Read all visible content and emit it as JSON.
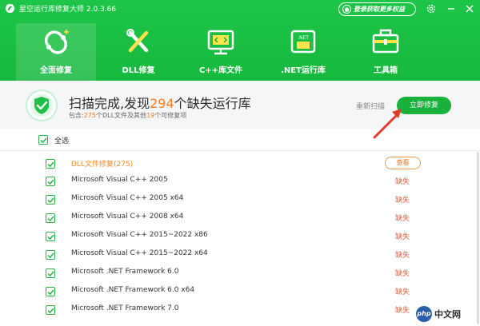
{
  "app": {
    "title": "星空运行库修复大师 2.0.3.66"
  },
  "titlebar": {
    "login_label": "登录获取更多权益",
    "icons": [
      "settings-icon",
      "minimize-icon",
      "close-icon"
    ]
  },
  "nav": {
    "items": [
      {
        "label": "全面修复",
        "icon": "refresh-circle-icon",
        "active": true
      },
      {
        "label": "DLL修复",
        "icon": "wrench-icon"
      },
      {
        "label": "C++库文件",
        "icon": "code-monitor-icon"
      },
      {
        "label": ".NET运行库",
        "icon": "net-folder-icon"
      },
      {
        "label": "工具箱",
        "icon": "toolbox-icon"
      }
    ]
  },
  "summary": {
    "title_prefix": "扫描完成,发现",
    "title_count": "294",
    "title_suffix": "个缺失运行库",
    "sub_prefix": "包含:",
    "sub_dll_count": "275",
    "sub_middle": "个DLL文件及其他",
    "sub_other_count": "19",
    "sub_suffix": "个可修复项",
    "rescan_label": "重新扫描",
    "fix_label": "立即修复"
  },
  "list": {
    "select_all_label": "全选",
    "rows": [
      {
        "label": "DLL文件修复(275)",
        "action": "查看",
        "checked": true
      },
      {
        "label": "Microsoft Visual C++ 2005",
        "status": "缺失",
        "checked": true
      },
      {
        "label": "Microsoft Visual C++ 2005 x64",
        "status": "缺失",
        "checked": true
      },
      {
        "label": "Microsoft Visual C++ 2008 x64",
        "status": "缺失",
        "checked": true
      },
      {
        "label": "Microsoft Visual C++ 2015~2022 x86",
        "status": "缺失",
        "checked": true
      },
      {
        "label": "Microsoft Visual C++ 2015~2022 x64",
        "status": "缺失",
        "checked": true
      },
      {
        "label": "Microsoft .NET Framework 6.0",
        "status": "缺失",
        "checked": true
      },
      {
        "label": "Microsoft .NET Framework 6.0 x64",
        "status": "缺失",
        "checked": true
      },
      {
        "label": "Microsoft .NET Framework 7.0",
        "status": "缺失",
        "checked": true
      }
    ]
  },
  "watermark": {
    "logo": "php",
    "text": "中文网"
  },
  "colors": {
    "brand_green": "#1dc548",
    "accent_orange": "#ff7a1a",
    "missing_red": "#e85a3c"
  }
}
